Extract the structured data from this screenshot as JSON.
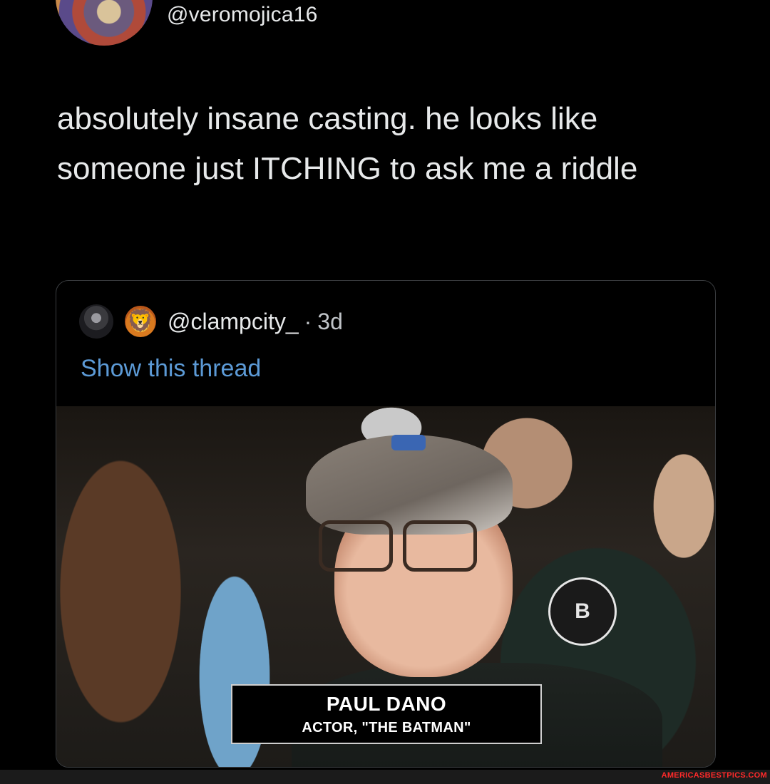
{
  "tweet": {
    "handle": "@veromojica16",
    "text": "absolutely insane casting. he looks like someone just ITCHING to ask me a riddle"
  },
  "quoted_tweet": {
    "handle": "@clampcity_",
    "separator": "·",
    "time": "3d",
    "show_thread_label": "Show this thread",
    "emoji": "🦁",
    "image": {
      "caption_name": "PAUL DANO",
      "caption_subtitle": "ACTOR, \"THE BATMAN\"",
      "logo_letter": "B"
    }
  },
  "watermark": {
    "text": "AMERICASBESTPICS.COM"
  },
  "colors": {
    "background": "#000000",
    "text": "#e7e9ea",
    "link": "#5c9ad6",
    "border": "#3a3d40",
    "watermark": "#ff2a2a"
  }
}
